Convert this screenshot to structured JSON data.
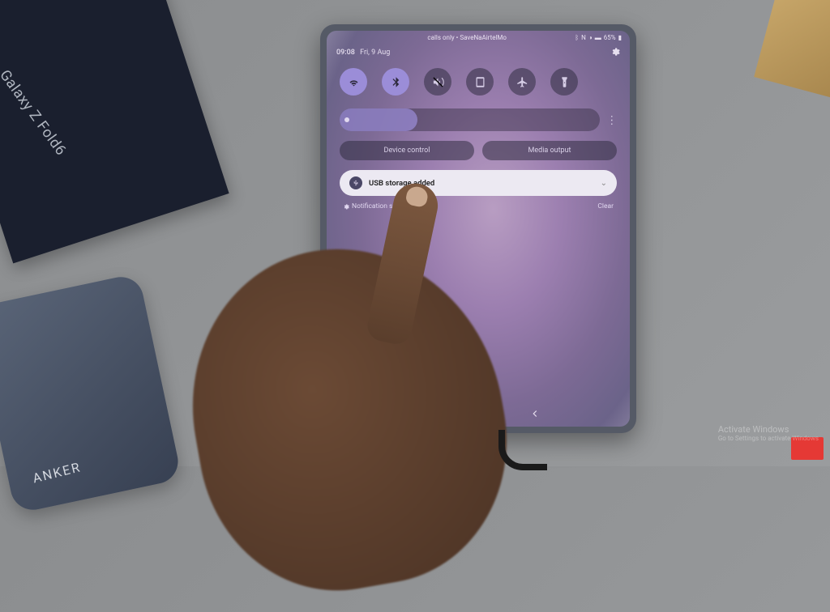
{
  "prop_box_label": "Galaxy Z Fold6",
  "prop_anker_label": "ANKER",
  "status": {
    "carrier": "calls only • SaveNaAirtelMo",
    "battery": "65%"
  },
  "header": {
    "time": "09:08",
    "date": "Fri, 9 Aug"
  },
  "pills": {
    "device_control": "Device control",
    "media_output": "Media output"
  },
  "notification": {
    "title": "USB storage added"
  },
  "footer": {
    "settings_label": "Notification settings",
    "clear_label": "Clear"
  },
  "watermark": {
    "title": "Activate Windows",
    "sub": "Go to Settings to activate Windows"
  }
}
